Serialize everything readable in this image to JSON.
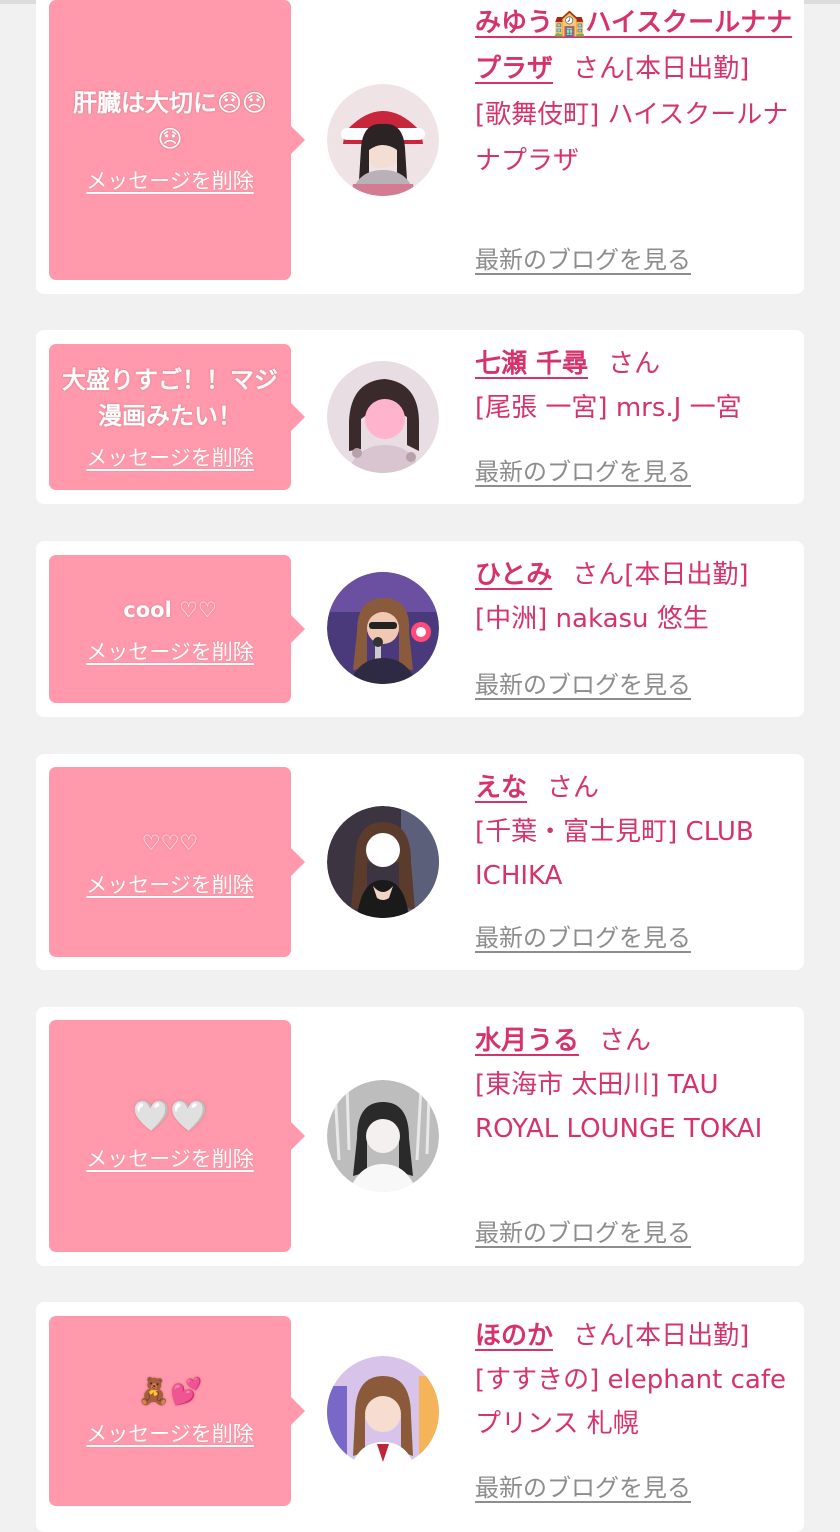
{
  "cards": [
    {
      "message": "肝臓は大切に😞😞😞",
      "delete_label": "メッセージを削除",
      "name": "みゆう🏫ハイスクールナナプラザ",
      "honorific": "さん",
      "status": "[本日出勤]",
      "shop": "[歌舞伎町] ハイスクールナナプラザ",
      "blog_label": "最新のブログを見る"
    },
    {
      "message": "大盛りすご！！マジ漫画みたい！",
      "delete_label": "メッセージを削除",
      "name": "七瀬 千尋",
      "honorific": "さん",
      "status": "",
      "shop": "[尾張 一宮] mrs.J 一宮",
      "blog_label": "最新のブログを見る"
    },
    {
      "message": "cool ♡♡",
      "delete_label": "メッセージを削除",
      "name": "ひとみ",
      "honorific": "さん",
      "status": "[本日出勤]",
      "shop": "[中洲] nakasu 悠生",
      "blog_label": "最新のブログを見る"
    },
    {
      "message": "♡♡♡",
      "delete_label": "メッセージを削除",
      "name": "えな",
      "honorific": "さん",
      "status": "",
      "shop": "[千葉・富士見町] CLUB ICHIKA",
      "blog_label": "最新のブログを見る"
    },
    {
      "message": "🤍🤍",
      "delete_label": "メッセージを削除",
      "name": "水月うる",
      "honorific": "さん",
      "status": "",
      "shop": "[東海市 太田川] TAU ROYAL LOUNGE TOKAI",
      "blog_label": "最新のブログを見る"
    },
    {
      "message": "🧸💕",
      "delete_label": "メッセージを削除",
      "name": "ほのか",
      "honorific": "さん",
      "status": "[本日出勤]",
      "shop": "[すすきの] elephant cafe プリンス 札幌",
      "blog_label": "最新のブログを見る"
    }
  ],
  "colors": {
    "background": "#f1f1f1",
    "card": "#ffffff",
    "bubble": "#ff99ab",
    "accent": "#d6336c",
    "link_gray": "#8d8d8d"
  }
}
